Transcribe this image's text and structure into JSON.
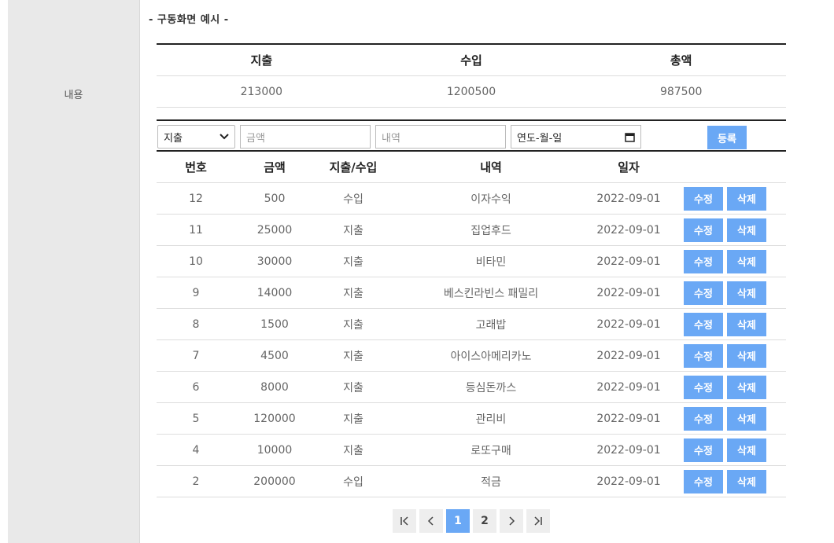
{
  "sidebar": {
    "label": "내용"
  },
  "section_title": "- 구동화면 예시 -",
  "summary": {
    "headers": [
      "지출",
      "수입",
      "총액"
    ],
    "values": [
      "213000",
      "1200500",
      "987500"
    ]
  },
  "form": {
    "type_selected": "지출",
    "amount_placeholder": "금액",
    "memo_placeholder": "내역",
    "date_placeholder": "연도-월-일",
    "register_label": "등록"
  },
  "table": {
    "headers": [
      "번호",
      "금액",
      "지출/수입",
      "내역",
      "일자"
    ],
    "edit_label": "수정",
    "delete_label": "삭제",
    "rows": [
      {
        "no": "12",
        "amount": "500",
        "type": "수입",
        "memo": "이자수익",
        "date": "2022-09-01"
      },
      {
        "no": "11",
        "amount": "25000",
        "type": "지출",
        "memo": "집업후드",
        "date": "2022-09-01"
      },
      {
        "no": "10",
        "amount": "30000",
        "type": "지출",
        "memo": "비타민",
        "date": "2022-09-01"
      },
      {
        "no": "9",
        "amount": "14000",
        "type": "지출",
        "memo": "베스킨라빈스 패밀리",
        "date": "2022-09-01"
      },
      {
        "no": "8",
        "amount": "1500",
        "type": "지출",
        "memo": "고래밥",
        "date": "2022-09-01"
      },
      {
        "no": "7",
        "amount": "4500",
        "type": "지출",
        "memo": "아이스아메리카노",
        "date": "2022-09-01"
      },
      {
        "no": "6",
        "amount": "8000",
        "type": "지출",
        "memo": "등심돈까스",
        "date": "2022-09-01"
      },
      {
        "no": "5",
        "amount": "120000",
        "type": "지출",
        "memo": "관리비",
        "date": "2022-09-01"
      },
      {
        "no": "4",
        "amount": "10000",
        "type": "지출",
        "memo": "로또구매",
        "date": "2022-09-01"
      },
      {
        "no": "2",
        "amount": "200000",
        "type": "수입",
        "memo": "적금",
        "date": "2022-09-01"
      }
    ]
  },
  "pagination": {
    "first_icon": "first-page-icon",
    "prev_icon": "chevron-left-icon",
    "pages": [
      "1",
      "2"
    ],
    "active_page": "1",
    "next_icon": "chevron-right-icon",
    "last_icon": "last-page-icon"
  },
  "colors": {
    "accent": "#6aa8f5",
    "sidebar_bg": "#e9e9e9"
  }
}
